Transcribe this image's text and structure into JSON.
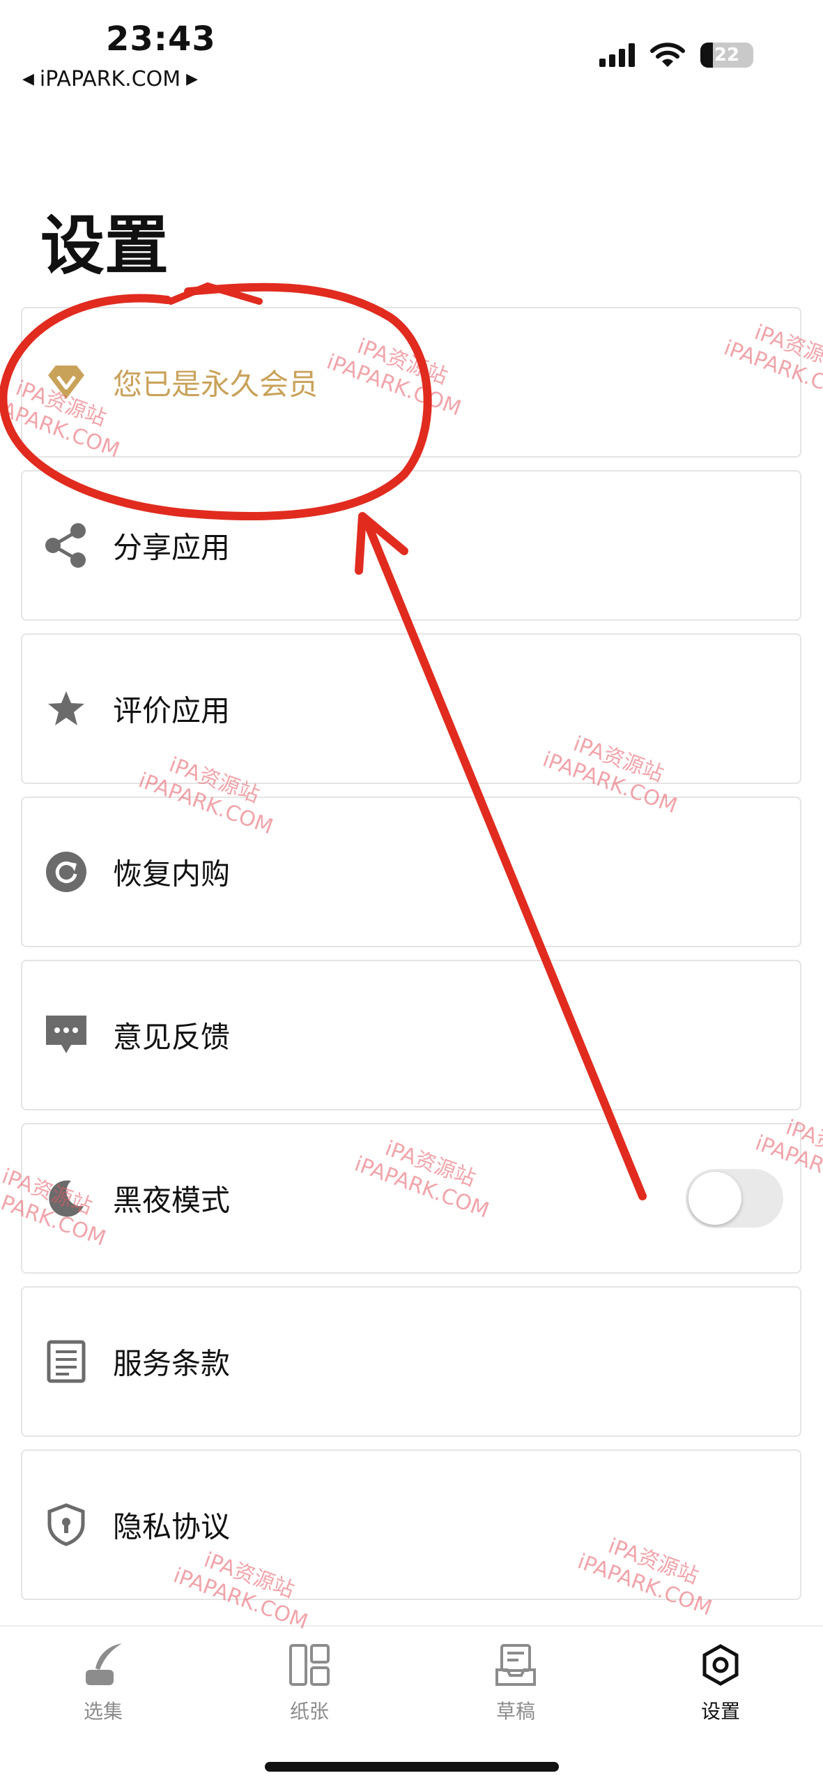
{
  "status_bar": {
    "time": "23:43",
    "back_label": "iPAPARK.COM",
    "battery": "22"
  },
  "page": {
    "title": "设置"
  },
  "settings": [
    {
      "label": "您已是永久会员",
      "icon": "diamond-icon",
      "color": "#c9a25a"
    },
    {
      "label": "分享应用",
      "icon": "share-icon"
    },
    {
      "label": "评价应用",
      "icon": "star-icon"
    },
    {
      "label": "恢复内购",
      "icon": "refresh-icon"
    },
    {
      "label": "意见反馈",
      "icon": "chat-bubble-icon"
    },
    {
      "label": "黑夜模式",
      "icon": "moon-icon",
      "toggle": false
    },
    {
      "label": "服务条款",
      "icon": "document-icon"
    },
    {
      "label": "隐私协议",
      "icon": "shield-icon"
    }
  ],
  "tabs": [
    {
      "label": "选集",
      "icon": "quill-icon"
    },
    {
      "label": "纸张",
      "icon": "layout-icon"
    },
    {
      "label": "草稿",
      "icon": "draft-tray-icon"
    },
    {
      "label": "设置",
      "icon": "settings-icon",
      "active": true
    }
  ],
  "watermark": {
    "line1": "iPA资源站",
    "line2": "iPAPARK.COM"
  },
  "colors": {
    "annotation_red": "#e12b1f",
    "member_gold": "#c9a25a",
    "icon_gray": "#6b6b6b"
  }
}
